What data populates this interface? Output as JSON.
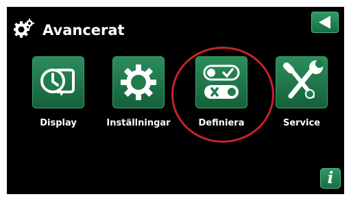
{
  "header": {
    "title": "Avancerat",
    "settings_icon": "gears-icon",
    "back_icon": "back-arrow-icon"
  },
  "menu": {
    "items": [
      {
        "label": "Display",
        "icon": "display-clock-icon"
      },
      {
        "label": "Inställningar",
        "icon": "gear-icon"
      },
      {
        "label": "Definiera",
        "icon": "toggle-switches-icon",
        "highlighted": true
      },
      {
        "label": "Service",
        "icon": "tools-icon"
      }
    ]
  },
  "footer": {
    "info_label": "i",
    "info_icon": "info-icon"
  },
  "colors": {
    "background": "#000000",
    "tile_green": "#1e7a4b",
    "highlight_ring": "#c8232c",
    "text": "#ffffff"
  }
}
